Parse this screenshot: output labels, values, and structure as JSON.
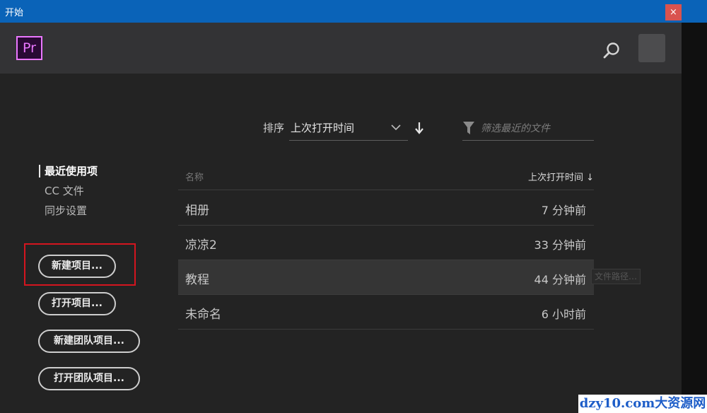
{
  "window": {
    "title": "开始",
    "close_glyph": "×"
  },
  "header": {
    "logo_text": "Pr",
    "search_icon": "search-icon",
    "avatar": "avatar"
  },
  "toolbar": {
    "sort_label": "排序",
    "sort_value": "上次打开时间",
    "sort_direction_icon": "arrow-down-icon",
    "filter_placeholder": "筛选最近的文件",
    "filter_value": ""
  },
  "sidebar": {
    "items": [
      {
        "label": "最近使用项",
        "active": true
      },
      {
        "label": "CC 文件",
        "active": false
      },
      {
        "label": "同步设置",
        "active": false
      }
    ],
    "buttons": [
      "新建项目...",
      "打开项目...",
      "新建团队项目...",
      "打开团队项目..."
    ]
  },
  "table": {
    "columns": {
      "name": "名称",
      "time": "上次打开时间 ↓"
    },
    "rows": [
      {
        "name": "相册",
        "time": "7 分钟前"
      },
      {
        "name": "凉凉2",
        "time": "33 分钟前"
      },
      {
        "name": "教程",
        "time": "44 分钟前"
      },
      {
        "name": "未命名",
        "time": "6 小时前"
      }
    ]
  },
  "tooltip": "文件路径…",
  "watermark": "dzy10.com大资源网",
  "colors": {
    "titlebar": "#0a63b8",
    "close": "#d9534f",
    "logo_accent": "#ea77ff",
    "highlight_box": "#d4151f"
  }
}
